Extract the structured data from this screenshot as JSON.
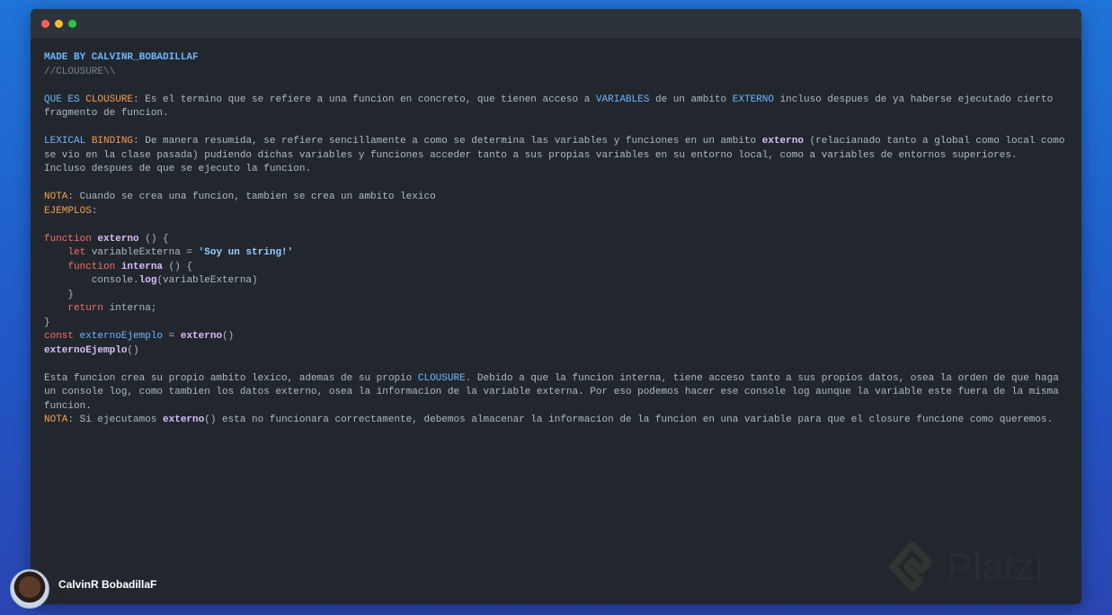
{
  "window": {
    "dots": [
      "#ff5f56",
      "#ffbd2e",
      "#27c93f"
    ]
  },
  "lines": [
    [
      {
        "t": "MADE BY CALVINR_BOBADILLAF",
        "c": "blue c-bold"
      }
    ],
    [
      {
        "t": "//CLOUSURE\\\\",
        "c": "comment"
      }
    ],
    [],
    [
      {
        "t": "QUE ES ",
        "c": "blue"
      },
      {
        "t": "CLOUSURE",
        "c": "orange"
      },
      {
        "t": ": Es el termino que se refiere a una funcion en concreto, que tienen acceso a ",
        "c": "text"
      },
      {
        "t": "VARIABLES",
        "c": "blue"
      },
      {
        "t": " de un ambito ",
        "c": "text"
      },
      {
        "t": "EXTERNO",
        "c": "blue"
      },
      {
        "t": " incluso despues de ya haberse ejecutado cierto",
        "c": "text"
      }
    ],
    [
      {
        "t": "fragmento de funcion.",
        "c": "text"
      }
    ],
    [],
    [
      {
        "t": "LEXICAL ",
        "c": "blue"
      },
      {
        "t": "BINDING",
        "c": "orange"
      },
      {
        "t": ": De manera resumida, se refiere sencillamente a como se determina las variables y funciones en un ambito ",
        "c": "text"
      },
      {
        "t": "externo",
        "c": "purple"
      },
      {
        "t": " (relacianado tanto a global como local como",
        "c": "text"
      }
    ],
    [
      {
        "t": "se vio en la clase pasada) pudiendo dichas variables y funciones acceder tanto a sus propias variables en su entorno local, como a variables de entornos superiores.",
        "c": "text"
      }
    ],
    [
      {
        "t": "Incluso despues de que se ejecuto la funcion.",
        "c": "text"
      }
    ],
    [],
    [
      {
        "t": "NOTA",
        "c": "orange"
      },
      {
        "t": ": Cuando se crea una funcion, tambien se crea un ambito lexico",
        "c": "text"
      }
    ],
    [
      {
        "t": "EJEMPLOS",
        "c": "orange"
      },
      {
        "t": ":",
        "c": "text"
      }
    ],
    [],
    [
      {
        "t": "function ",
        "c": "kw"
      },
      {
        "t": "externo",
        "c": "purple"
      },
      {
        "t": " () {",
        "c": "text"
      }
    ],
    [
      {
        "t": "    let ",
        "c": "kw"
      },
      {
        "t": "variableExterna = ",
        "c": "text"
      },
      {
        "t": "'Soy un string!'",
        "c": "str"
      }
    ],
    [
      {
        "t": "    function ",
        "c": "kw"
      },
      {
        "t": "interna",
        "c": "purple"
      },
      {
        "t": " () {",
        "c": "text"
      }
    ],
    [
      {
        "t": "        console.",
        "c": "text"
      },
      {
        "t": "log",
        "c": "purple"
      },
      {
        "t": "(variableExterna)",
        "c": "text"
      }
    ],
    [
      {
        "t": "    }",
        "c": "text"
      }
    ],
    [
      {
        "t": "    return ",
        "c": "kw"
      },
      {
        "t": "interna;",
        "c": "text"
      }
    ],
    [
      {
        "t": "}",
        "c": "text"
      }
    ],
    [
      {
        "t": "const ",
        "c": "kw"
      },
      {
        "t": "externoEjemplo",
        "c": "var"
      },
      {
        "t": " = ",
        "c": "text"
      },
      {
        "t": "externo",
        "c": "purple"
      },
      {
        "t": "()",
        "c": "text"
      }
    ],
    [
      {
        "t": "externoEjemplo",
        "c": "purple"
      },
      {
        "t": "()",
        "c": "text"
      }
    ],
    [],
    [
      {
        "t": "Esta funcion crea su propio ambito lexico, ademas de su propio ",
        "c": "text"
      },
      {
        "t": "CLOUSURE",
        "c": "blue"
      },
      {
        "t": ". Debido a que la funcion interna, tiene acceso tanto a sus propios datos, osea la orden de que haga",
        "c": "text"
      }
    ],
    [
      {
        "t": "un console log, como tambien los datos externo, osea la informacion de la variable externa. Por eso podemos hacer ese console log aunque la variable este fuera de la misma",
        "c": "text"
      }
    ],
    [
      {
        "t": "funcion.",
        "c": "text"
      }
    ],
    [
      {
        "t": "NOTA",
        "c": "orange"
      },
      {
        "t": ": Si ejecutamos ",
        "c": "text"
      },
      {
        "t": "externo",
        "c": "purple"
      },
      {
        "t": "() esta no funcionara correctamente, debemos almacenar la informacion de la funcion en una variable para que el closure funcione como queremos.",
        "c": "text"
      }
    ]
  ],
  "watermark": {
    "text": "Platzi"
  },
  "author": {
    "name": "CalvinR BobadillaF",
    "social": "𝕏"
  }
}
